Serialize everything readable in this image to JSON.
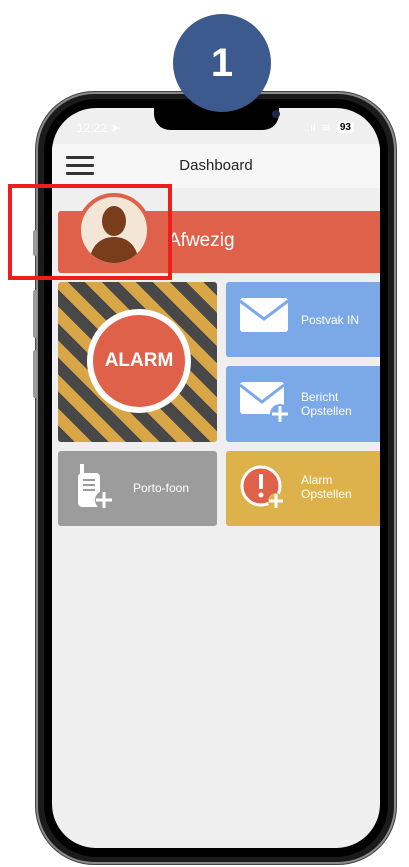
{
  "step_badge": "1",
  "status_bar": {
    "time": "12:22",
    "signal": "..ıl",
    "wifi": "≋",
    "battery": "93"
  },
  "header": {
    "title": "Dashboard",
    "menu_icon": "hamburger-menu-icon"
  },
  "status_tile": {
    "label": "Afwezig",
    "avatar_icon": "user-silhouette-icon",
    "color": "#e0614a"
  },
  "alarm_tile": {
    "label": "ALARM",
    "stripe_colors": [
      "#484848",
      "#d9a647"
    ]
  },
  "tiles": [
    {
      "label_line1": "Postvak IN",
      "label_line2": "",
      "icon": "envelope-icon",
      "color": "#7ba8e7"
    },
    {
      "label_line1": "Bericht",
      "label_line2": "Opstellen",
      "icon": "envelope-plus-icon",
      "color": "#7ba8e7"
    },
    {
      "label_line1": "Porto-foon",
      "label_line2": "",
      "icon": "walkie-talkie-plus-icon",
      "color": "#9c9c9c"
    },
    {
      "label_line1": "Alarm",
      "label_line2": "Opstellen",
      "icon": "alert-plus-icon",
      "color": "#ddb24b"
    }
  ],
  "annotation": {
    "highlight_color": "#f01d1d"
  }
}
